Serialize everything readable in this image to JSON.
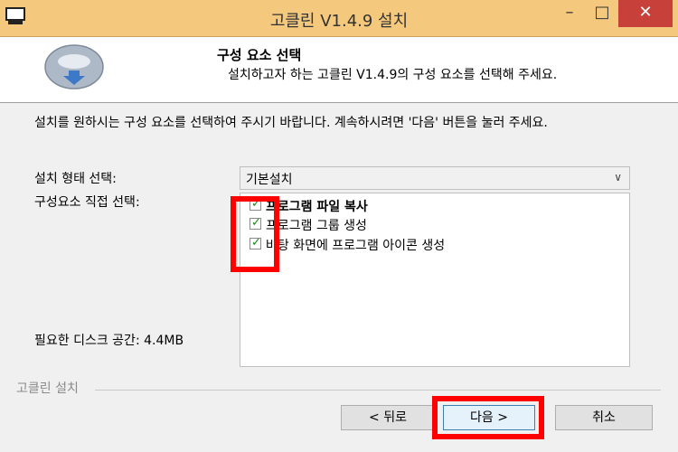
{
  "window": {
    "title": "고클린 V1.4.9 설치",
    "minimize_label": "–",
    "maximize_label": "□",
    "close_label": "✕"
  },
  "header": {
    "title": "구성 요소 선택",
    "subtitle": "설치하고자 하는 고클린 V1.4.9의 구성 요소를 선택해 주세요."
  },
  "body": {
    "description": "설치를 원하시는 구성 요소를 선택하여 주시기 바랍니다. 계속하시려면 '다음' 버튼을 눌러 주세요.",
    "install_type_label": "설치 형태 선택:",
    "install_type_value": "기본설치",
    "components_label": "구성요소 직접 선택:",
    "components": [
      {
        "label": "프로그램 파일 복사",
        "checked": true,
        "bold": true
      },
      {
        "label": "프로그램 그룹 생성",
        "checked": true,
        "bold": false
      },
      {
        "label": "바탕 화면에 프로그램 아이콘 생성",
        "checked": true,
        "bold": false
      }
    ],
    "disk_space_label": "필요한 디스크 공간: 4.4MB"
  },
  "footer": {
    "group_label": "고클린 설치",
    "back_label": "< 뒤로",
    "next_label": "다음 >",
    "cancel_label": "취소"
  },
  "colors": {
    "titlebar": "#f5c97d",
    "close_button": "#c7413a",
    "highlight": "#ff0000",
    "checkmark": "#1a8a1a"
  }
}
